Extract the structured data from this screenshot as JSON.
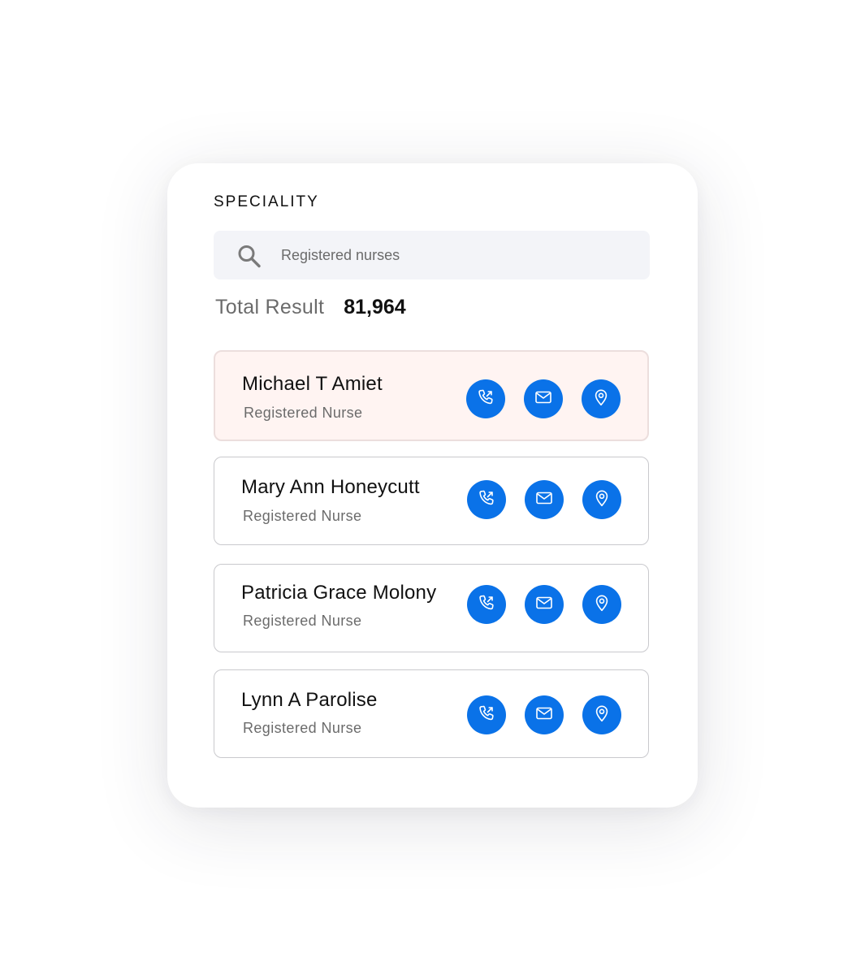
{
  "panel": {
    "heading": "SPECIALITY",
    "search": {
      "value": "Registered nurses",
      "icon": "search-icon"
    },
    "total": {
      "label": "Total Result",
      "value": "81,964"
    }
  },
  "colors": {
    "accent": "#0a72e8",
    "highlight_background": "#fff4f2",
    "text_primary": "#111111",
    "text_secondary": "#6b6b6b"
  },
  "results": [
    {
      "name": "Michael T Amiet",
      "role": "Registered Nurse",
      "highlighted": true,
      "actions": [
        "phone-icon",
        "mail-icon",
        "location-pin-icon"
      ]
    },
    {
      "name": "Mary Ann Honeycutt",
      "role": "Registered Nurse",
      "highlighted": false,
      "actions": [
        "phone-icon",
        "mail-icon",
        "location-pin-icon"
      ]
    },
    {
      "name": "Patricia Grace Molony",
      "role": "Registered Nurse",
      "highlighted": false,
      "actions": [
        "phone-icon",
        "mail-icon",
        "location-pin-icon"
      ]
    },
    {
      "name": "Lynn A Parolise",
      "role": "Registered Nurse",
      "highlighted": false,
      "actions": [
        "phone-icon",
        "mail-icon",
        "location-pin-icon"
      ]
    }
  ]
}
